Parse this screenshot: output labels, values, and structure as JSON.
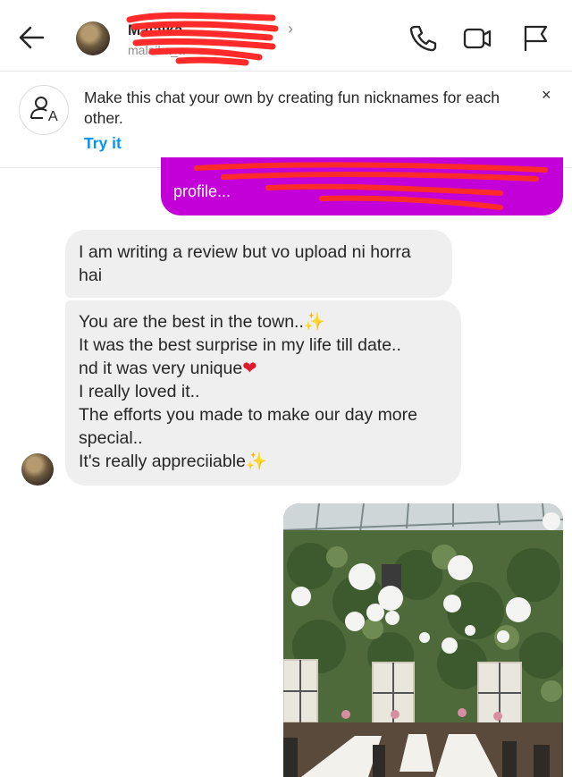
{
  "header": {
    "name": "Malaika",
    "username": "malaika_a",
    "icons": [
      "back-arrow-icon",
      "phone-icon",
      "video-icon",
      "flag-icon",
      "chevron-right-icon"
    ]
  },
  "banner": {
    "text": "Make this chat your own by creating fun nicknames for each other.",
    "cta": "Try it",
    "close": "×",
    "icon_glyph": "A"
  },
  "sent_message": {
    "visible_text": "profile...",
    "color": "#c400d8"
  },
  "messages": [
    {
      "lines": [
        "I am writing a review but vo upload ni horra",
        "hai"
      ]
    },
    {
      "lines": [
        "You are the best in the town..",
        "It was the best surprise in my life till date..",
        "nd it was very unique",
        "I really loved it..",
        "The efforts you made to make our day more",
        "special..",
        "It's really appreciiable"
      ],
      "emojis": {
        "sparkle": "✨",
        "heart": "❤"
      }
    }
  ],
  "colors": {
    "accent": "#0095f6",
    "bubble_received": "#efefef",
    "redaction": "#ff2a2a"
  }
}
